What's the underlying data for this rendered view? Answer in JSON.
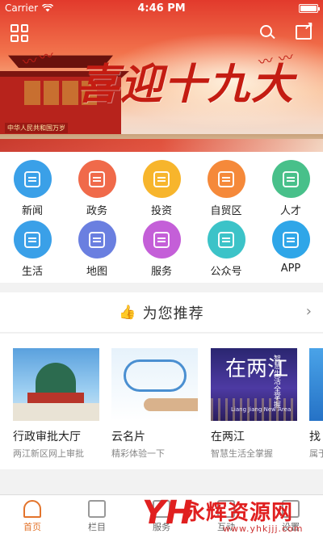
{
  "status_bar": {
    "carrier": "Carrier",
    "time": "4:46 PM"
  },
  "banner": {
    "title": "喜迎十九大",
    "plaque": "中华人民共和国万岁"
  },
  "menu": {
    "rows": [
      [
        {
          "label": "新闻",
          "color": "#3aa0e8",
          "icon": "news-icon"
        },
        {
          "label": "政务",
          "color": "#f06a4a",
          "icon": "government-icon"
        },
        {
          "label": "投资",
          "color": "#f7b52c",
          "icon": "handshake-icon"
        },
        {
          "label": "自贸区",
          "color": "#f5893a",
          "icon": "free-trade-icon"
        },
        {
          "label": "人才",
          "color": "#48c08a",
          "icon": "people-icon"
        }
      ],
      [
        {
          "label": "生活",
          "color": "#3aa0e8",
          "icon": "coffee-icon"
        },
        {
          "label": "地图",
          "color": "#6a7fe0",
          "icon": "map-icon"
        },
        {
          "label": "服务",
          "color": "#c45fd8",
          "icon": "briefcase-icon"
        },
        {
          "label": "公众号",
          "color": "#3cc3c8",
          "icon": "chat-icon"
        },
        {
          "label": "APP",
          "color": "#2fa6e8",
          "icon": "phone-icon"
        }
      ]
    ]
  },
  "recommend": {
    "title": "为您推荐",
    "more": "›"
  },
  "cards": [
    {
      "title": "行政审批大厅",
      "subtitle": "两江新区网上审批"
    },
    {
      "title": "云名片",
      "subtitle": "精彩体验一下"
    },
    {
      "title": "在两江",
      "subtitle": "智慧生活全掌握",
      "img_text": "在两江",
      "img_vtext": "智慧生活全掌握",
      "img_sub": "Liang Jiang New Area"
    },
    {
      "title": "找",
      "subtitle": "属于"
    }
  ],
  "bottom_nav": {
    "items": [
      {
        "label": "首页",
        "active": true
      },
      {
        "label": "栏目",
        "active": false
      },
      {
        "label": "服务",
        "active": false
      },
      {
        "label": "互动",
        "active": false
      },
      {
        "label": "设置",
        "active": false
      }
    ]
  },
  "watermark": {
    "logo": "YH",
    "text": "永辉资源网",
    "url": "www.yhkjjj.com"
  }
}
